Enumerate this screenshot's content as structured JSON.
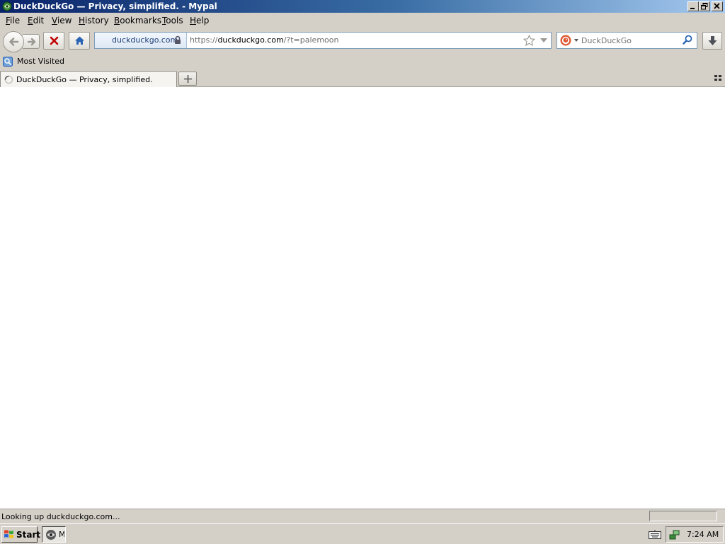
{
  "window": {
    "title": "DuckDuckGo — Privacy, simplified. - Mypal",
    "controls": [
      "minimize",
      "restore",
      "close"
    ]
  },
  "menubar": {
    "items": [
      {
        "label": "File",
        "u": "F",
        "rest": "ile"
      },
      {
        "label": "Edit",
        "u": "E",
        "rest": "dit"
      },
      {
        "label": "View",
        "u": "V",
        "rest": "iew"
      },
      {
        "label": "History",
        "u": "H",
        "rest": "istory"
      },
      {
        "label": "Bookmarks",
        "u": "B",
        "rest": "ookmarks"
      },
      {
        "label": "Tools",
        "u": "T",
        "rest": "ools"
      },
      {
        "label": "Help",
        "u": "H",
        "rest": "elp"
      }
    ]
  },
  "navbar": {
    "identity_label": "duckduckgo.com",
    "url_prefix": "https://",
    "url_host": "duckduckgo.com",
    "url_rest": "/?t=palemoon",
    "search_placeholder": "DuckDuckGo",
    "icons": [
      "back-icon",
      "forward-icon",
      "stop-icon",
      "home-icon",
      "lock-icon",
      "star-icon",
      "search-icon",
      "download-icon"
    ]
  },
  "bookmarks": {
    "items": [
      {
        "label": "Most Visited"
      }
    ]
  },
  "tabs": {
    "items": [
      {
        "label": "DuckDuckGo — Privacy, simplified."
      }
    ]
  },
  "status": {
    "text": "Looking up duckduckgo.com..."
  },
  "taskbar": {
    "start_label": "Start",
    "task_label": "M",
    "clock": "7:24 AM"
  },
  "colors": {
    "titlebar_start": "#0a246a",
    "titlebar_end": "#a6caf0",
    "chrome": "#d4d0c8",
    "stop": "#c00000",
    "home": "#2a64b4",
    "identity_text": "#1d3f7a"
  }
}
